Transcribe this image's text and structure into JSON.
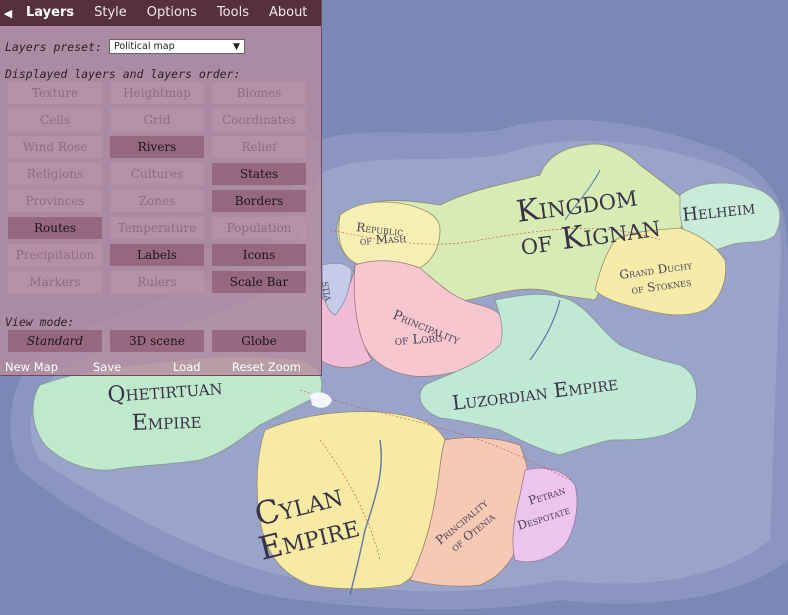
{
  "menu": {
    "collapse_glyph": "◀",
    "tabs": [
      "Layers",
      "Style",
      "Options",
      "Tools",
      "About"
    ],
    "active": "Layers"
  },
  "preset": {
    "label": "Layers preset:",
    "value": "Political map",
    "arrow": "▼"
  },
  "layers": {
    "heading": "Displayed layers and layers order:",
    "buttons": [
      {
        "label": "Texture",
        "on": false
      },
      {
        "label": "Heightmap",
        "on": false
      },
      {
        "label": "Biomes",
        "on": false
      },
      {
        "label": "Cells",
        "on": false
      },
      {
        "label": "Grid",
        "on": false
      },
      {
        "label": "Coordinates",
        "on": false
      },
      {
        "label": "Wind Rose",
        "on": false
      },
      {
        "label": "Rivers",
        "on": true
      },
      {
        "label": "Relief",
        "on": false
      },
      {
        "label": "Religions",
        "on": false
      },
      {
        "label": "Cultures",
        "on": false
      },
      {
        "label": "States",
        "on": true
      },
      {
        "label": "Provinces",
        "on": false
      },
      {
        "label": "Zones",
        "on": false
      },
      {
        "label": "Borders",
        "on": true
      },
      {
        "label": "Routes",
        "on": true
      },
      {
        "label": "Temperature",
        "on": false
      },
      {
        "label": "Population",
        "on": false
      },
      {
        "label": "Precipitation",
        "on": false
      },
      {
        "label": "Labels",
        "on": true
      },
      {
        "label": "Icons",
        "on": true
      },
      {
        "label": "Markers",
        "on": false
      },
      {
        "label": "Rulers",
        "on": false
      },
      {
        "label": "Scale Bar",
        "on": true
      }
    ]
  },
  "view_mode": {
    "heading": "View mode:",
    "buttons": [
      "Standard",
      "3D scene",
      "Globe"
    ],
    "active": "Standard"
  },
  "actions": [
    "New Map",
    "Save",
    "Load",
    "Reset Zoom"
  ],
  "map_labels": {
    "kingdom_line1": "Kingdom",
    "kingdom_line2": "of Kignan",
    "helheim": "Helheim",
    "republic_line1": "Republic",
    "republic_line2": "of Mash",
    "duchy_line1": "Grand Duchy",
    "duchy_line2": "of Stoknes",
    "principality_lorg_line1": "Principality",
    "principality_lorg_line2": "of Lorg",
    "luzordian": "Luzordian Empire",
    "qhetirtuan_line1": "Qhetirtuan",
    "qhetirtuan_line2": "Empire",
    "cylan_line1": "Cylan",
    "cylan_line2": "Empire",
    "principality_otenia_line1": "Principality",
    "principality_otenia_line2": "of Otenia",
    "petran_line1": "Petran",
    "petran_line2": "Despotate",
    "partial_stia": "stia"
  },
  "colors": {
    "ocean": "#7a86b4",
    "kingdom": "#d7ebb4",
    "helheim": "#c8ecd9",
    "republic": "#f6efb4",
    "duchy": "#f6ecaa",
    "lorg": "#f6c7cf",
    "luzordian": "#bfe8d6",
    "qhetirtuan": "#bfe8cc",
    "cylan": "#f6eaa4",
    "otenia": "#f5c9b4",
    "petran": "#edc4ee"
  }
}
